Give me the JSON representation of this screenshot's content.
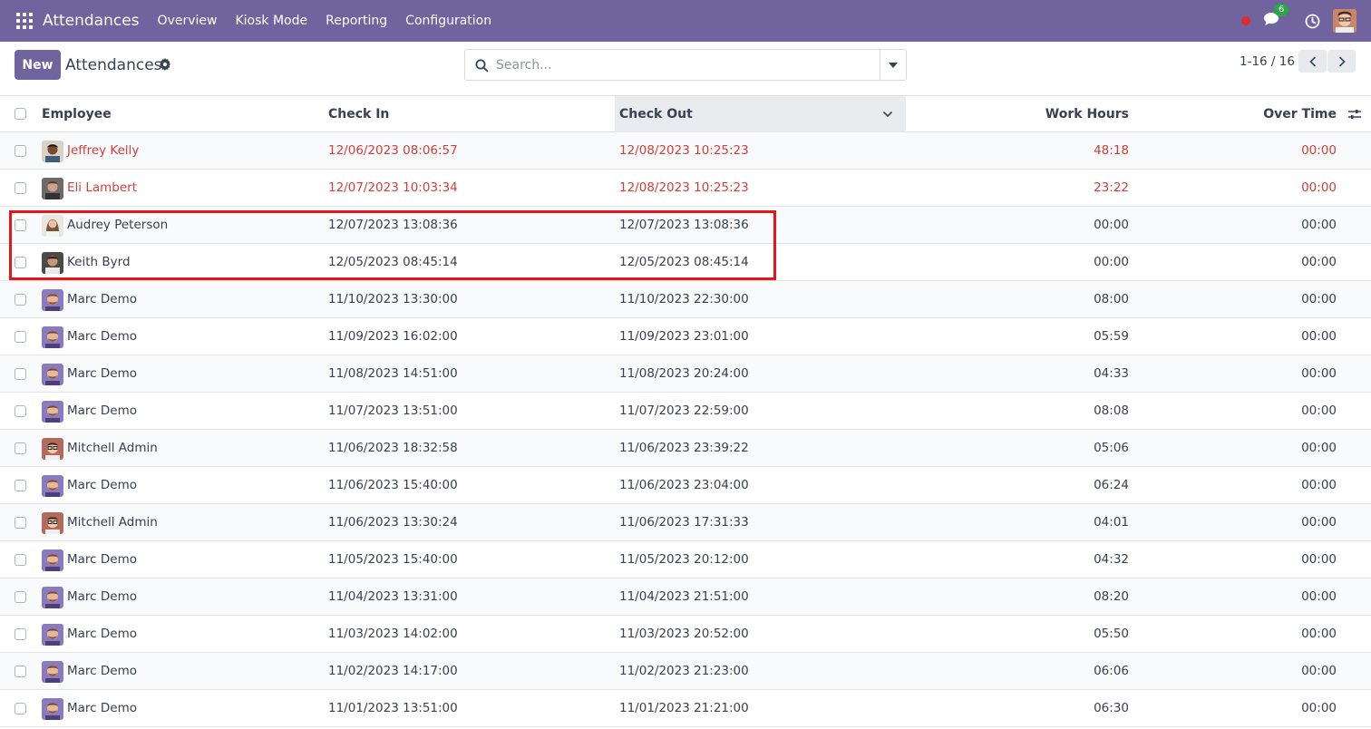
{
  "navbar": {
    "brand": "Attendances",
    "menu": [
      "Overview",
      "Kiosk Mode",
      "Reporting",
      "Configuration"
    ],
    "messages_count": "6"
  },
  "control_panel": {
    "new_label": "New",
    "title": "Attendances",
    "search_placeholder": "Search...",
    "pager": "1-16 / 16"
  },
  "table": {
    "columns": [
      "Employee",
      "Check In",
      "Check Out",
      "Work Hours",
      "Over Time"
    ],
    "rows": [
      {
        "employee": "Jeffrey Kelly",
        "check_in": "12/06/2023 08:06:57",
        "check_out": "12/08/2023 10:25:23",
        "work_hours": "48:18",
        "over_time": "00:00",
        "status": "red",
        "avatar": "jeffrey"
      },
      {
        "employee": "Eli Lambert",
        "check_in": "12/07/2023 10:03:34",
        "check_out": "12/08/2023 10:25:23",
        "work_hours": "23:22",
        "over_time": "00:00",
        "status": "red",
        "avatar": "eli"
      },
      {
        "employee": "Audrey Peterson",
        "check_in": "12/07/2023 13:08:36",
        "check_out": "12/07/2023 13:08:36",
        "work_hours": "00:00",
        "over_time": "00:00",
        "status": "normal",
        "avatar": "audrey"
      },
      {
        "employee": "Keith Byrd",
        "check_in": "12/05/2023 08:45:14",
        "check_out": "12/05/2023 08:45:14",
        "work_hours": "00:00",
        "over_time": "00:00",
        "status": "normal",
        "avatar": "keith"
      },
      {
        "employee": "Marc Demo",
        "check_in": "11/10/2023 13:30:00",
        "check_out": "11/10/2023 22:30:00",
        "work_hours": "08:00",
        "over_time": "00:00",
        "status": "normal",
        "avatar": "marc"
      },
      {
        "employee": "Marc Demo",
        "check_in": "11/09/2023 16:02:00",
        "check_out": "11/09/2023 23:01:00",
        "work_hours": "05:59",
        "over_time": "00:00",
        "status": "normal",
        "avatar": "marc"
      },
      {
        "employee": "Marc Demo",
        "check_in": "11/08/2023 14:51:00",
        "check_out": "11/08/2023 20:24:00",
        "work_hours": "04:33",
        "over_time": "00:00",
        "status": "normal",
        "avatar": "marc"
      },
      {
        "employee": "Marc Demo",
        "check_in": "11/07/2023 13:51:00",
        "check_out": "11/07/2023 22:59:00",
        "work_hours": "08:08",
        "over_time": "00:00",
        "status": "normal",
        "avatar": "marc"
      },
      {
        "employee": "Mitchell Admin",
        "check_in": "11/06/2023 18:32:58",
        "check_out": "11/06/2023 23:39:22",
        "work_hours": "05:06",
        "over_time": "00:00",
        "status": "normal",
        "avatar": "mitchell"
      },
      {
        "employee": "Marc Demo",
        "check_in": "11/06/2023 15:40:00",
        "check_out": "11/06/2023 23:04:00",
        "work_hours": "06:24",
        "over_time": "00:00",
        "status": "normal",
        "avatar": "marc"
      },
      {
        "employee": "Mitchell Admin",
        "check_in": "11/06/2023 13:30:24",
        "check_out": "11/06/2023 17:31:33",
        "work_hours": "04:01",
        "over_time": "00:00",
        "status": "normal",
        "avatar": "mitchell"
      },
      {
        "employee": "Marc Demo",
        "check_in": "11/05/2023 15:40:00",
        "check_out": "11/05/2023 20:12:00",
        "work_hours": "04:32",
        "over_time": "00:00",
        "status": "normal",
        "avatar": "marc"
      },
      {
        "employee": "Marc Demo",
        "check_in": "11/04/2023 13:31:00",
        "check_out": "11/04/2023 21:51:00",
        "work_hours": "08:20",
        "over_time": "00:00",
        "status": "normal",
        "avatar": "marc"
      },
      {
        "employee": "Marc Demo",
        "check_in": "11/03/2023 14:02:00",
        "check_out": "11/03/2023 20:52:00",
        "work_hours": "05:50",
        "over_time": "00:00",
        "status": "normal",
        "avatar": "marc"
      },
      {
        "employee": "Marc Demo",
        "check_in": "11/02/2023 14:17:00",
        "check_out": "11/02/2023 21:23:00",
        "work_hours": "06:06",
        "over_time": "00:00",
        "status": "normal",
        "avatar": "marc"
      },
      {
        "employee": "Marc Demo",
        "check_in": "11/01/2023 13:51:00",
        "check_out": "11/01/2023 21:21:00",
        "work_hours": "06:30",
        "over_time": "00:00",
        "status": "normal",
        "avatar": "marc"
      }
    ]
  },
  "colors": {
    "navbar": "#71639e",
    "danger_text": "#d23f3a",
    "highlight_box": "#e4161a"
  }
}
